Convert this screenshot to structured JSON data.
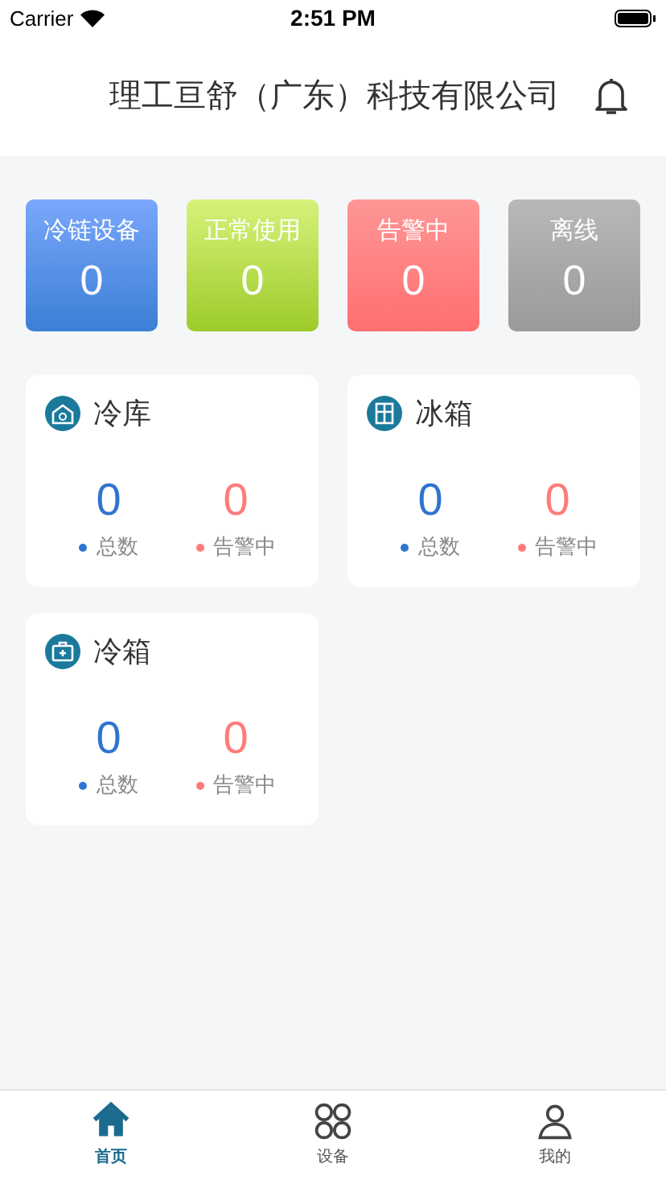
{
  "status_bar": {
    "carrier": "Carrier",
    "time": "2:51 PM"
  },
  "header": {
    "title": "理工亘舒（广东）科技有限公司"
  },
  "stats": [
    {
      "label": "冷链设备",
      "value": "0",
      "kind": "blue"
    },
    {
      "label": "正常使用",
      "value": "0",
      "kind": "green"
    },
    {
      "label": "告警中",
      "value": "0",
      "kind": "red"
    },
    {
      "label": "离线",
      "value": "0",
      "kind": "grey"
    }
  ],
  "cards": [
    {
      "title": "冷库",
      "kind": "coldroom",
      "total": "0",
      "total_label": "总数",
      "alarm": "0",
      "alarm_label": "告警中"
    },
    {
      "title": "冰箱",
      "kind": "fridge",
      "total": "0",
      "total_label": "总数",
      "alarm": "0",
      "alarm_label": "告警中"
    },
    {
      "title": "冷箱",
      "kind": "coolbox",
      "total": "0",
      "total_label": "总数",
      "alarm": "0",
      "alarm_label": "告警中"
    }
  ],
  "tabs": [
    {
      "label": "首页",
      "kind": "home",
      "selected": true
    },
    {
      "label": "设备",
      "kind": "devices",
      "selected": false
    },
    {
      "label": "我的",
      "kind": "profile",
      "selected": false
    }
  ]
}
